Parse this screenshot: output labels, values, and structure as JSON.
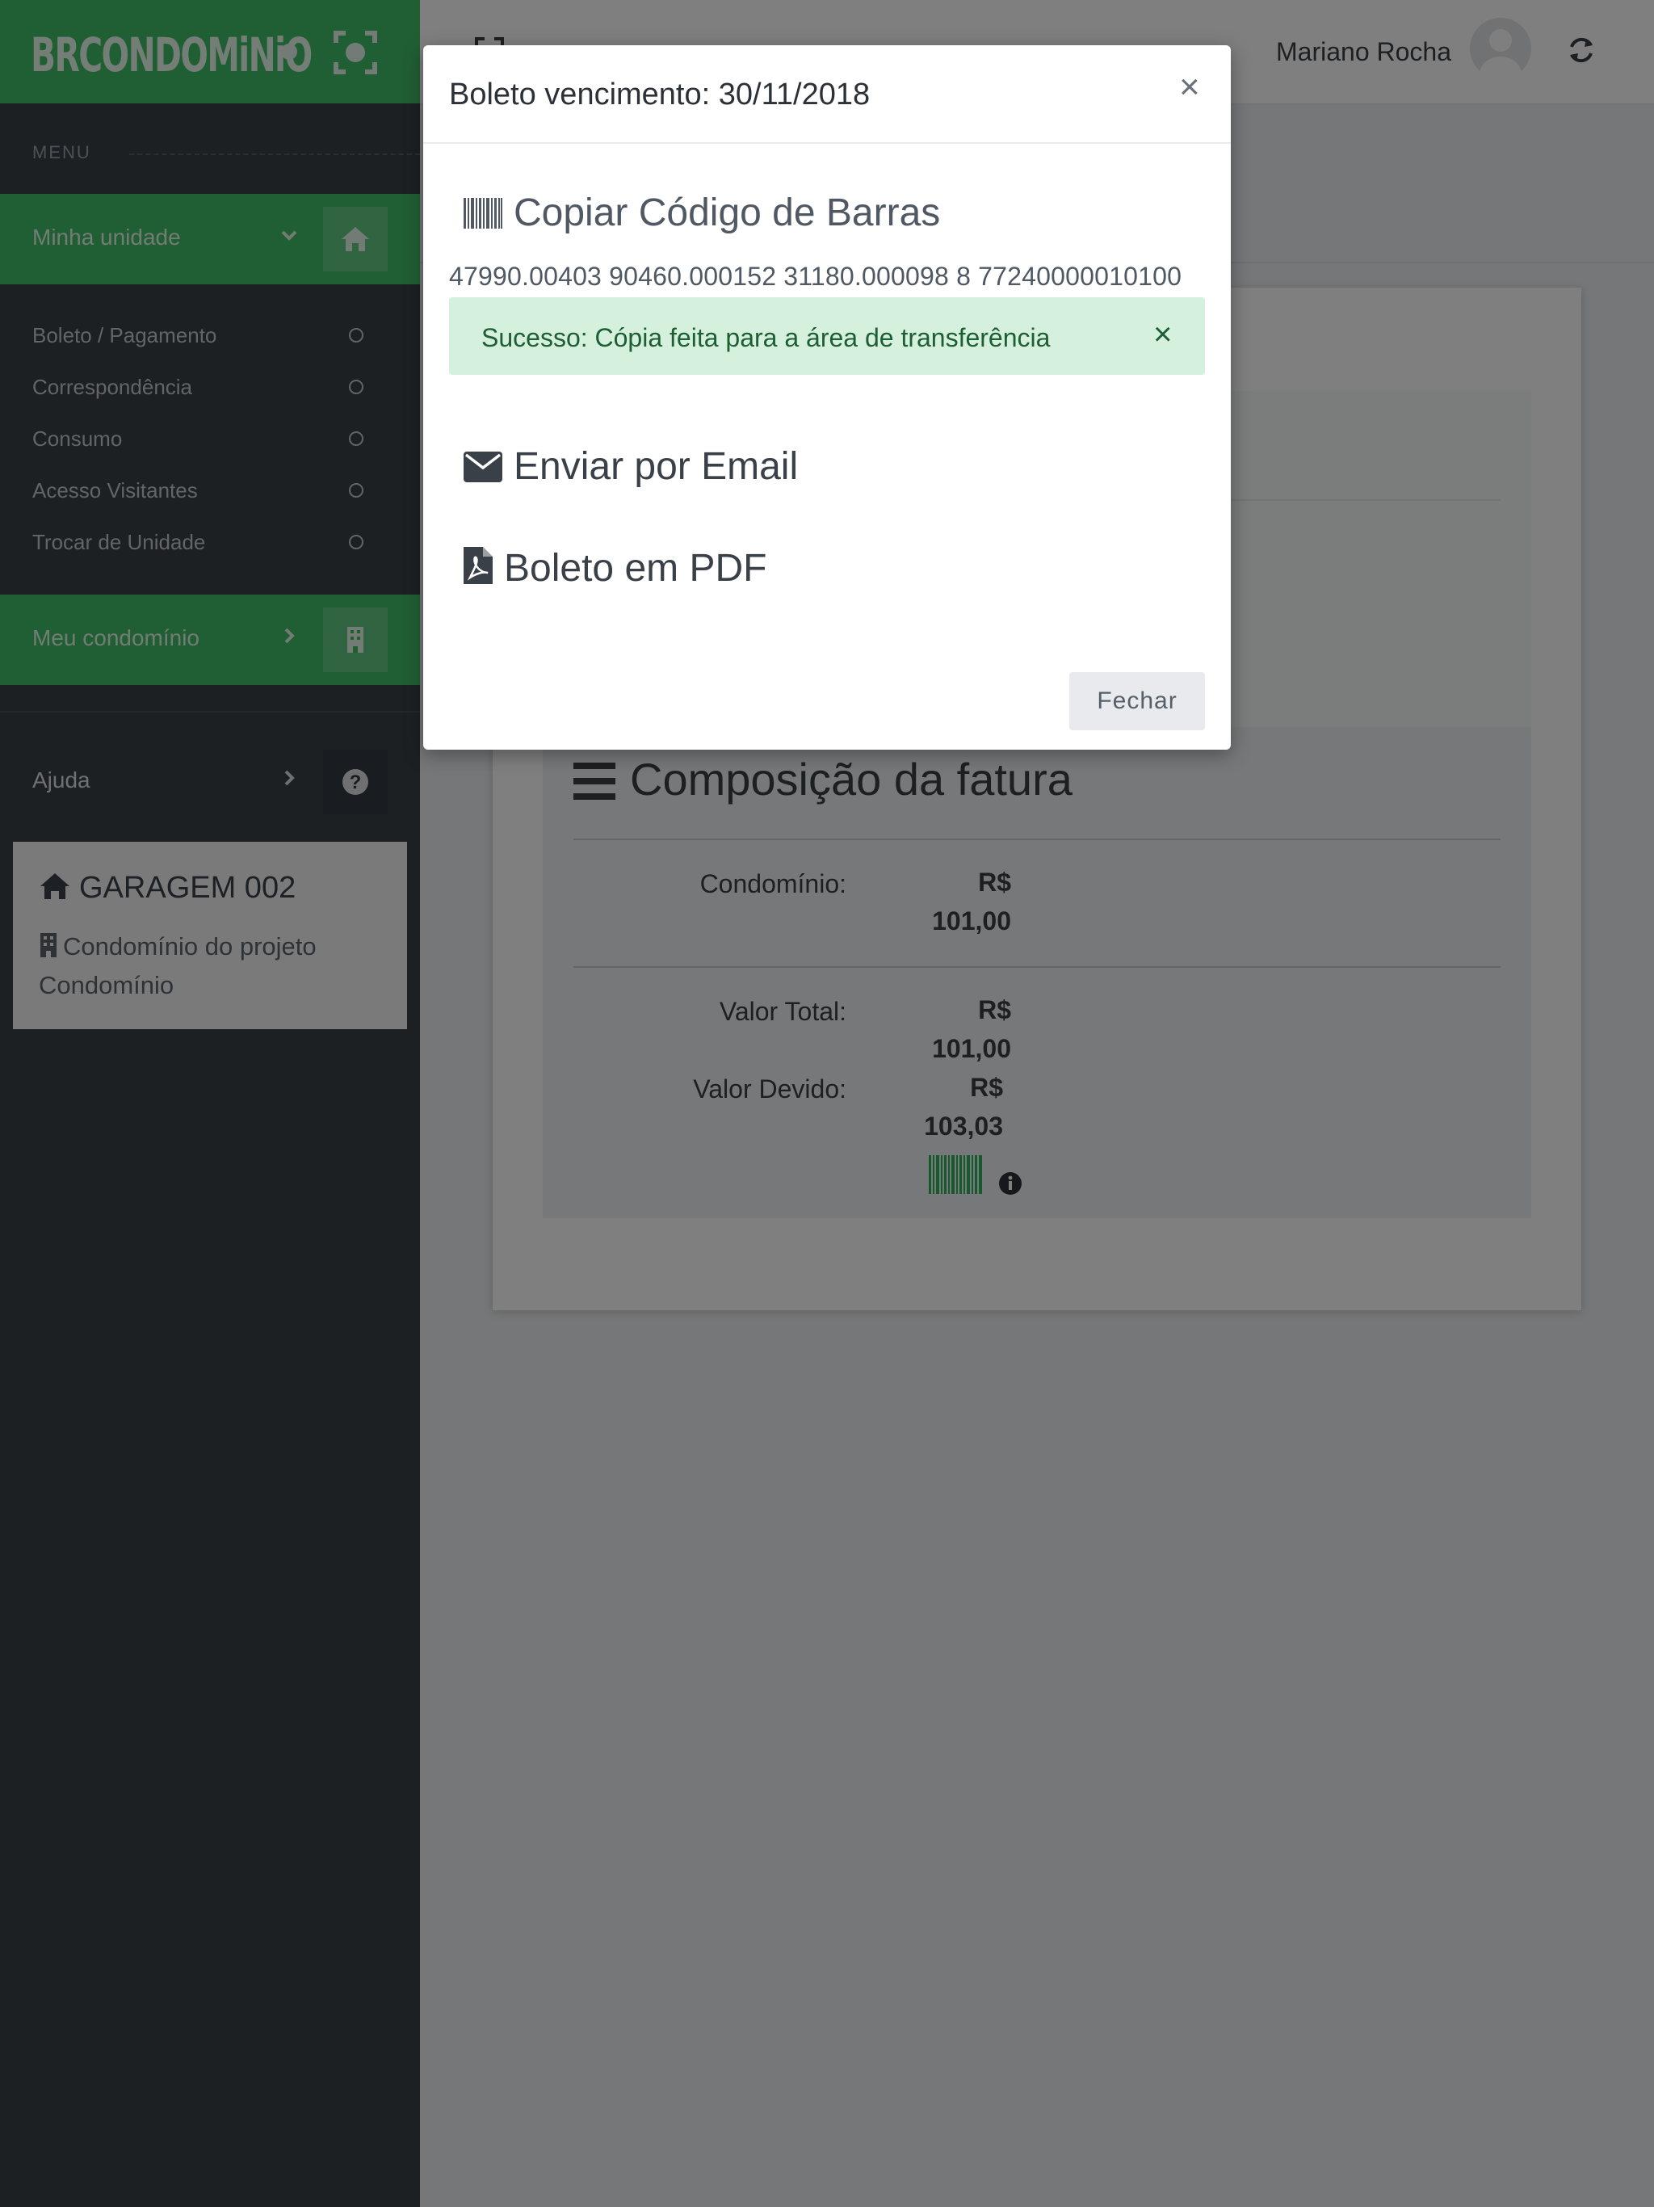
{
  "sidebar": {
    "logo": "BRCONDOMiNiO",
    "menu_label": "MENU",
    "group_unit": {
      "label": "Minha unidade",
      "icon": "home-icon"
    },
    "unit_items": [
      {
        "label": "Boleto / Pagamento"
      },
      {
        "label": "Correspondência"
      },
      {
        "label": "Consumo"
      },
      {
        "label": "Acesso Visitantes"
      },
      {
        "label": "Trocar de Unidade"
      }
    ],
    "group_condo": {
      "label": "Meu condomínio",
      "icon": "building-icon"
    },
    "help": {
      "label": "Ajuda",
      "icon": "question-icon"
    },
    "unit_card": {
      "title": "GARAGEM 002",
      "subtitle": "Condomínio do projeto Condomínio"
    }
  },
  "topbar": {
    "user_name": "Mariano Rocha"
  },
  "invoice": {
    "composition_title": "Composição da fatura",
    "rows": [
      {
        "label": "Condomínio:",
        "value": "R$ 101,00"
      },
      {
        "label": "Valor Total:",
        "value": "R$ 101,00"
      },
      {
        "label": "Valor Devido:",
        "value": "R$ 103,03"
      }
    ]
  },
  "modal": {
    "title": "Boleto vencimento: 30/11/2018",
    "close_symbol": "×",
    "copy_title": "Copiar Código de Barras",
    "barcode_number": "47990.00403 90460.000152 31180.000098 8 77240000010100",
    "alert_text": "Sucesso: Cópia feita para a área de transferência",
    "alert_close": "×",
    "email_title": "Enviar por Email",
    "pdf_title": "Boleto em PDF",
    "close_button": "Fechar"
  },
  "colors": {
    "brand_green": "#41bf68",
    "sidebar_dark": "#3a4047",
    "alert_bg": "#d5f0dd",
    "alert_text": "#1d5e34"
  }
}
